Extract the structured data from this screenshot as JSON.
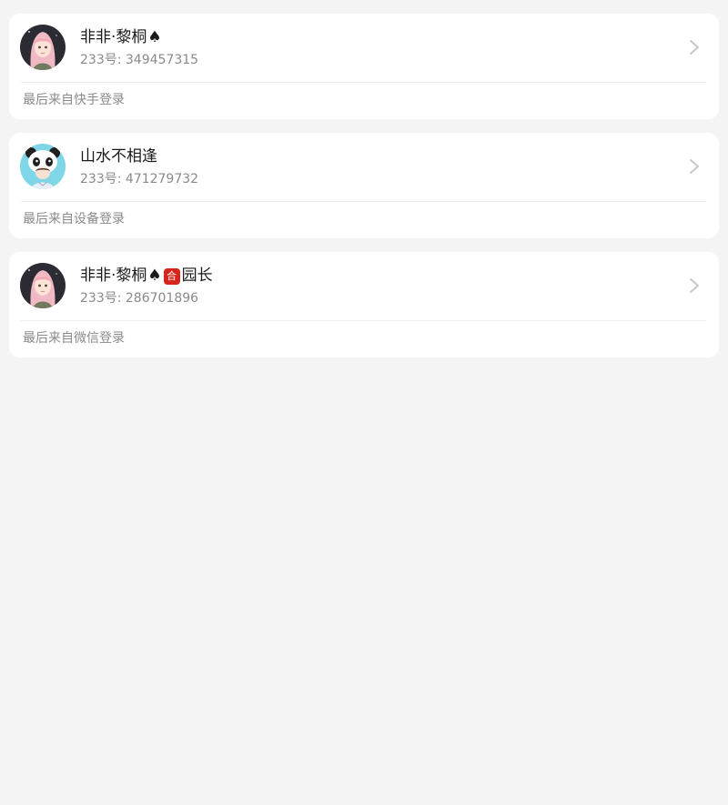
{
  "accounts": [
    {
      "name": "非非·黎桐",
      "suffix_icon": "spade-icon",
      "spade_glyph": "♠",
      "badge": "",
      "title": "",
      "uid": "233号: 349457315",
      "login_source": "最后来自快手登录",
      "avatar": "anime-girl-pink-hair-avatar"
    },
    {
      "name": "山水不相逢",
      "suffix_icon": "",
      "spade_glyph": "",
      "badge": "",
      "title": "",
      "uid": "233号: 471279732",
      "login_source": "最后来自设备登录",
      "avatar": "panda-hood-character-avatar"
    },
    {
      "name": "非非·黎桐",
      "suffix_icon": "spade-icon",
      "spade_glyph": "♠",
      "badge": "合",
      "title": "园长",
      "uid": "233号: 286701896",
      "login_source": "最后来自微信登录",
      "avatar": "anime-girl-pink-hair-avatar"
    }
  ],
  "colors": {
    "background": "#f4f4f4",
    "card": "#ffffff",
    "name_text": "#1a1a1a",
    "secondary_text": "#8a8a8a",
    "badge_red": "#d6261c",
    "chevron": "#c8c8c8"
  }
}
